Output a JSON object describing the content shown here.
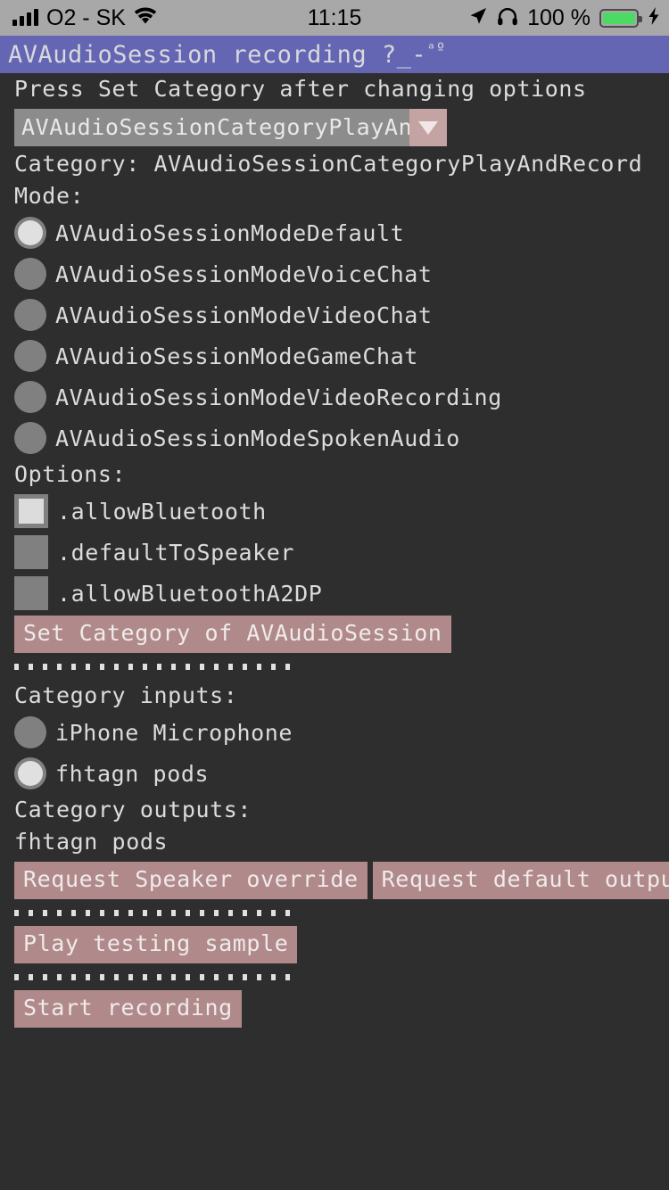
{
  "statusbar": {
    "carrier": "O2 - SK",
    "time": "11:15",
    "battery_pct": "100 %",
    "icons": {
      "signal": "signal-bars-icon",
      "wifi": "wifi-icon",
      "location": "location-arrow-icon",
      "headphones": "headphones-icon",
      "battery": "battery-icon",
      "charging": "lightning-bolt-icon"
    },
    "battery_color": "#4cd964",
    "bg_color": "#a8a8a8"
  },
  "navbar": {
    "title_main": "AVAudioSession recording ?_-",
    "title_sup": "ᵃº",
    "bg_color": "#6466b3"
  },
  "main": {
    "hint": "Press Set Category after changing options",
    "category_picker": {
      "value": "AVAudioSessionCategoryPlayAn",
      "full_value": "AVAudioSessionCategoryPlayAndRecord",
      "arrow": "chevron-down-icon"
    },
    "category_line": "Category: AVAudioSessionCategoryPlayAndRecord",
    "mode_heading": "Mode:",
    "modes": [
      {
        "label": "AVAudioSessionModeDefault",
        "selected": true
      },
      {
        "label": "AVAudioSessionModeVoiceChat",
        "selected": false
      },
      {
        "label": "AVAudioSessionModeVideoChat",
        "selected": false
      },
      {
        "label": "AVAudioSessionModeGameChat",
        "selected": false
      },
      {
        "label": "AVAudioSessionModeVideoRecording",
        "selected": false
      },
      {
        "label": "AVAudioSessionModeSpokenAudio",
        "selected": false
      }
    ],
    "options_heading": "Options:",
    "options": [
      {
        "label": ".allowBluetooth",
        "checked": true
      },
      {
        "label": ".defaultToSpeaker",
        "checked": false
      },
      {
        "label": ".allowBluetoothA2DP",
        "checked": false
      }
    ],
    "set_category_button": "Set Category of AVAudioSession",
    "inputs_heading": "Category inputs:",
    "inputs": [
      {
        "label": "iPhone Microphone",
        "selected": false
      },
      {
        "label": "fhtagn pods",
        "selected": true
      }
    ],
    "outputs_heading": "Category outputs:",
    "outputs_value": "fhtagn pods",
    "speaker_override_button": "Request Speaker override",
    "default_output_button": "Request default output",
    "play_sample_button": "Play testing sample",
    "start_recording_button": "Start recording",
    "button_color": "#b08a8a",
    "page_bg": "#2e2e2e",
    "separator_dots": 20
  }
}
